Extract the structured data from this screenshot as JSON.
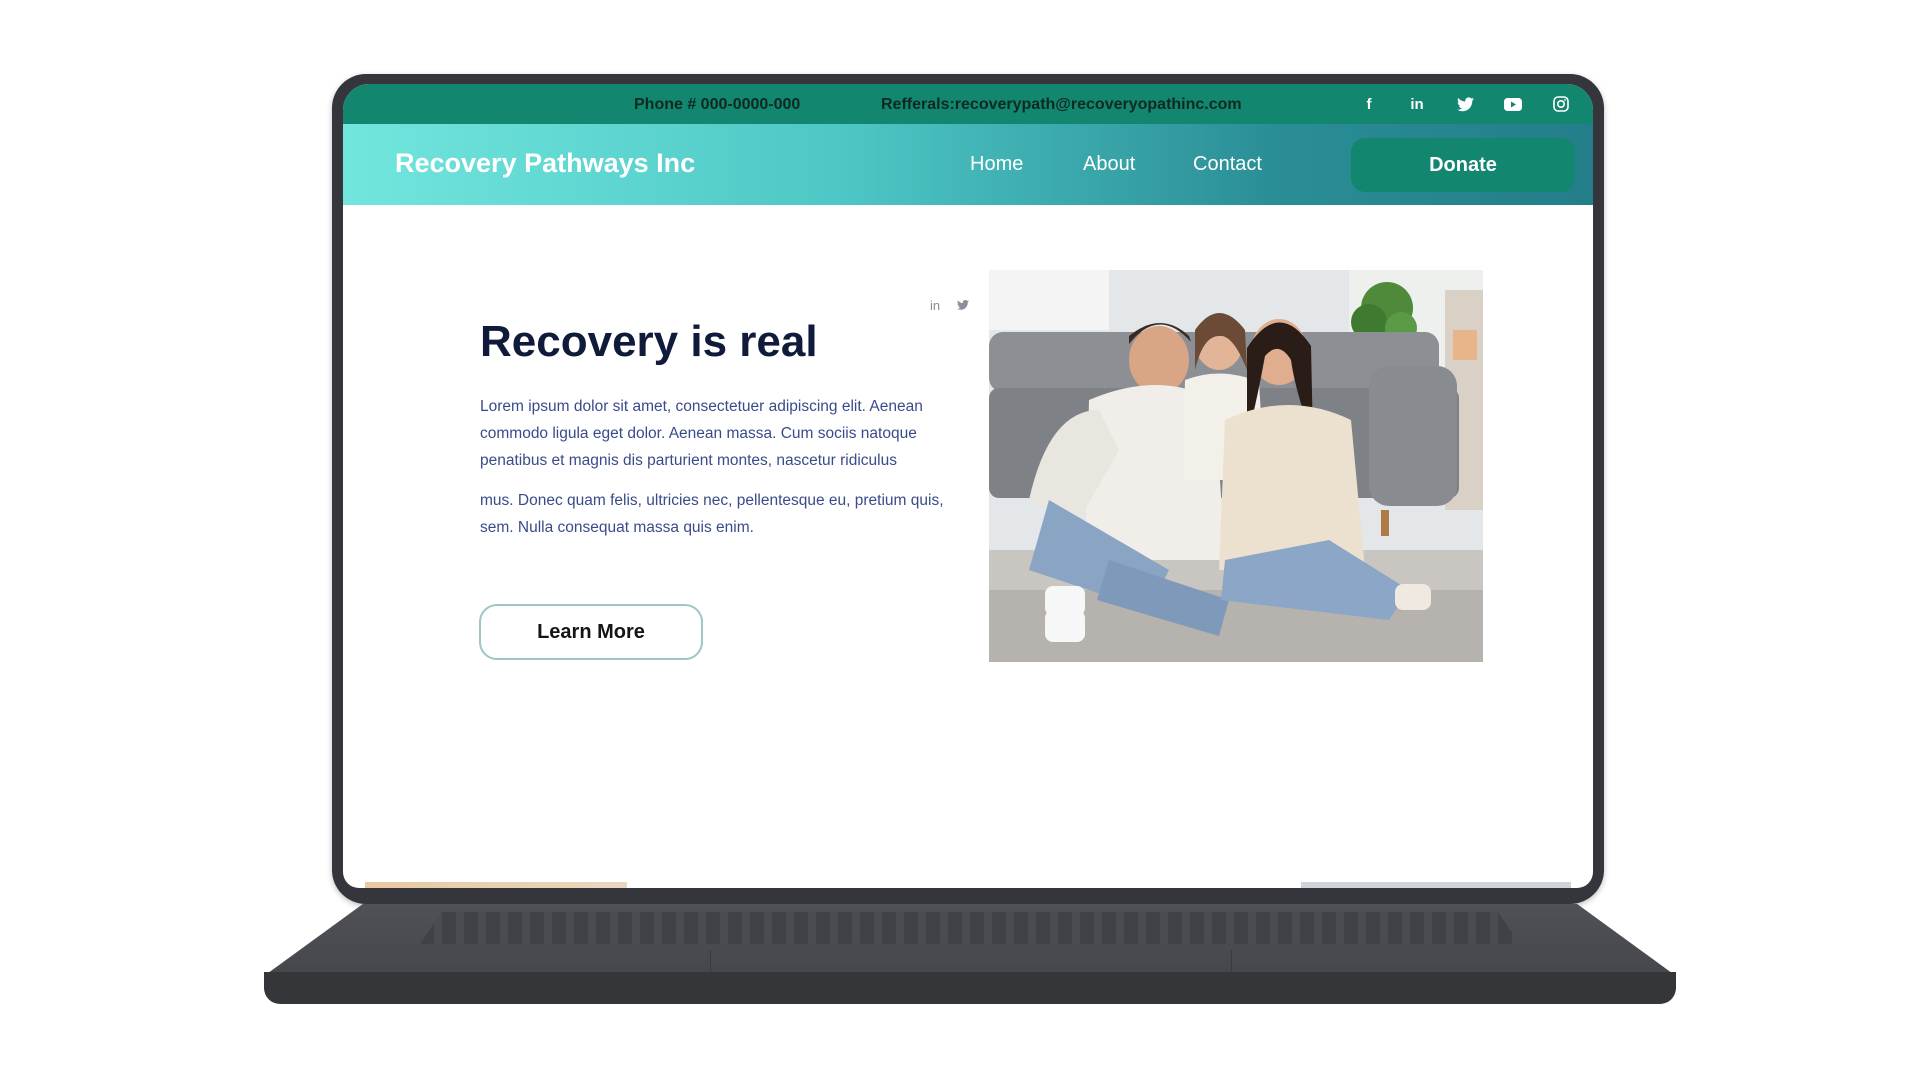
{
  "topbar": {
    "phone": "Phone # 000-0000-000",
    "referrals": "Refferals:recoverypath@recoveryopathinc.com",
    "social_icons": [
      "facebook-icon",
      "linkedin-icon",
      "twitter-icon",
      "youtube-icon",
      "instagram-icon"
    ]
  },
  "nav": {
    "brand": "Recovery Pathways Inc",
    "links": [
      "Home",
      "About",
      "Contact"
    ],
    "donate_label": "Donate"
  },
  "hero": {
    "title": "Recovery is real",
    "paragraph1": "Lorem ipsum dolor sit amet, consectetuer adipiscing elit. Aenean commodo ligula eget dolor. Aenean massa. Cum sociis natoque penatibus et magnis dis parturient montes, nascetur ridiculus",
    "paragraph2": "mus. Donec quam felis, ultricies nec, pellentesque eu, pretium quis, sem. Nulla consequat massa quis enim.",
    "cta_label": "Learn More",
    "share_icons": [
      "linkedin-icon",
      "twitter-icon"
    ]
  },
  "colors": {
    "topbar": "#12866e",
    "nav_gradient_start": "#72e6dd",
    "nav_gradient_end": "#237e8a",
    "donate": "#12866e",
    "title": "#101a3a",
    "body_text": "#3a4b8a"
  }
}
